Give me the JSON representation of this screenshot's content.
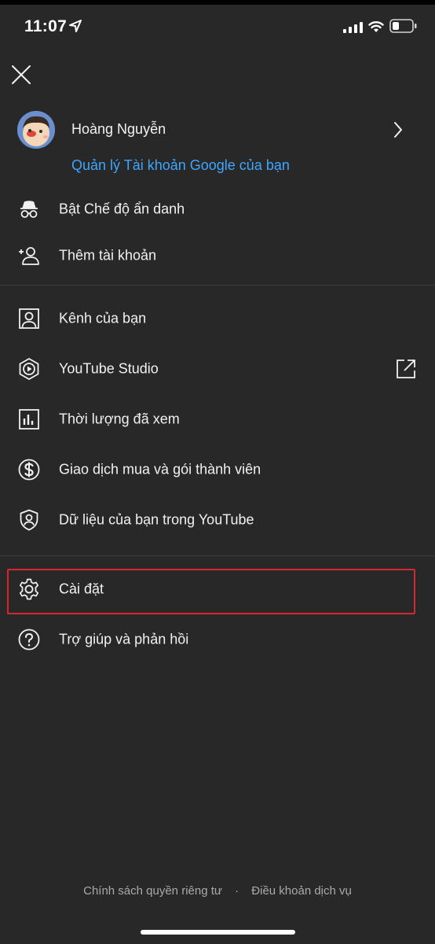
{
  "status_bar": {
    "time": "11:07"
  },
  "account": {
    "name": "Hoàng Nguyễn",
    "manage_link": "Quản lý Tài khoản Google của bạn"
  },
  "menu": {
    "incognito": "Bật Chế độ ẩn danh",
    "add_account": "Thêm tài khoản",
    "your_channel": "Kênh của bạn",
    "studio": "YouTube Studio",
    "time_watched": "Thời lượng đã xem",
    "purchases": "Giao dịch mua và gói thành viên",
    "your_data": "Dữ liệu của bạn trong YouTube",
    "settings": "Cài đặt",
    "help": "Trợ giúp và phản hồi"
  },
  "footer": {
    "privacy": "Chính sách quyền riêng tư",
    "separator": "·",
    "terms": "Điều khoản dịch vụ"
  },
  "colors": {
    "background": "#282828",
    "link": "#3ea6ff",
    "highlight": "#d7262f"
  }
}
